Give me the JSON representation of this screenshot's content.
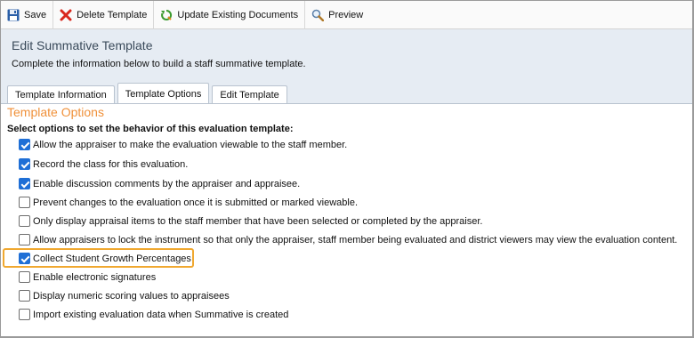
{
  "toolbar": {
    "save_label": "Save",
    "delete_label": "Delete Template",
    "update_label": "Update Existing Documents",
    "preview_label": "Preview"
  },
  "header": {
    "title": "Edit Summative Template",
    "subtitle": "Complete the information below to build a staff summative template."
  },
  "tabs": [
    {
      "label": "Template Information",
      "active": false
    },
    {
      "label": "Template Options",
      "active": true
    },
    {
      "label": "Edit Template",
      "active": false
    }
  ],
  "content": {
    "section_title": "Template Options",
    "instructions": "Select options to set the behavior of this evaluation template:",
    "options": [
      {
        "label": "Allow the appraiser to make the evaluation viewable to the staff member.",
        "checked": true
      },
      {
        "label": "Record the class for this evaluation.",
        "checked": true
      },
      {
        "label": "Enable discussion comments by the appraiser and appraisee.",
        "checked": true
      },
      {
        "label": "Prevent changes to the evaluation once it is submitted or marked viewable.",
        "checked": false
      },
      {
        "label": "Only display appraisal items to the staff member that have been selected or completed by the appraiser.",
        "checked": false
      },
      {
        "label": "Allow appraisers to lock the instrument so that only the appraiser, staff member being evaluated and district viewers may view the evaluation content.",
        "checked": false
      },
      {
        "label": "Collect Student Growth Percentages",
        "checked": true,
        "highlighted": true
      },
      {
        "label": "Enable electronic signatures",
        "checked": false
      },
      {
        "label": "Display numeric scoring values to appraisees",
        "checked": false
      },
      {
        "label": "Import existing evaluation data when Summative is created",
        "checked": false
      }
    ]
  },
  "colors": {
    "accent_orange": "#f0913a",
    "highlight_border": "#f0a830",
    "checkbox_blue": "#1f6fd6",
    "header_bg": "#e6ecf3"
  }
}
